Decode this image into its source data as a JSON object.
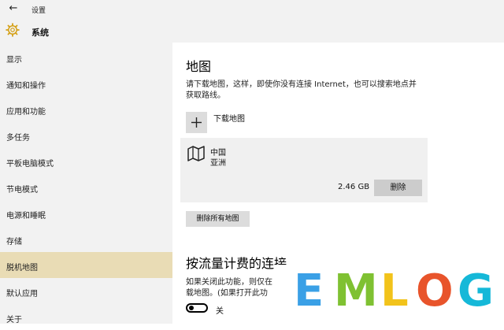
{
  "window": {
    "back_icon": "back-arrow-icon",
    "title": "设置"
  },
  "header": {
    "icon": "gear-icon",
    "title": "系统"
  },
  "sidebar": {
    "items": [
      {
        "label": "显示",
        "active": false
      },
      {
        "label": "通知和操作",
        "active": false
      },
      {
        "label": "应用和功能",
        "active": false
      },
      {
        "label": "多任务",
        "active": false
      },
      {
        "label": "平板电脑模式",
        "active": false
      },
      {
        "label": "节电模式",
        "active": false
      },
      {
        "label": "电源和睡眠",
        "active": false
      },
      {
        "label": "存储",
        "active": false
      },
      {
        "label": "脱机地图",
        "active": true
      },
      {
        "label": "默认应用",
        "active": false
      },
      {
        "label": "关于",
        "active": false
      }
    ]
  },
  "main": {
    "maps": {
      "heading": "地图",
      "description_line1": "请下载地图，这样，即使你没有连接 Internet，也可以搜索地点并",
      "description_line2": "获取路线。",
      "download_label": "下载地图",
      "downloaded": {
        "country": "中国",
        "continent": "亚洲",
        "size": "2.46 GB",
        "delete_label": "删除"
      },
      "delete_all_label": "删除所有地图"
    },
    "metered": {
      "heading": "按流量计费的连接",
      "description_line1": "如果关闭此功能，则仅在",
      "description_line2": "载地图。(如果打开此功",
      "toggle_state": "关",
      "toggle_on": false
    }
  },
  "watermark": {
    "letters": [
      "E",
      "M",
      "L",
      "O",
      "G"
    ],
    "colors": [
      "#3aa0e6",
      "#7fc132",
      "#f2c31b",
      "#e8542b",
      "#15b8d8"
    ]
  },
  "colors": {
    "chrome": "#f2f2f2",
    "active_nav": "#e9dcb5",
    "card": "#f0f0f0",
    "button": "#dcdcdc"
  }
}
